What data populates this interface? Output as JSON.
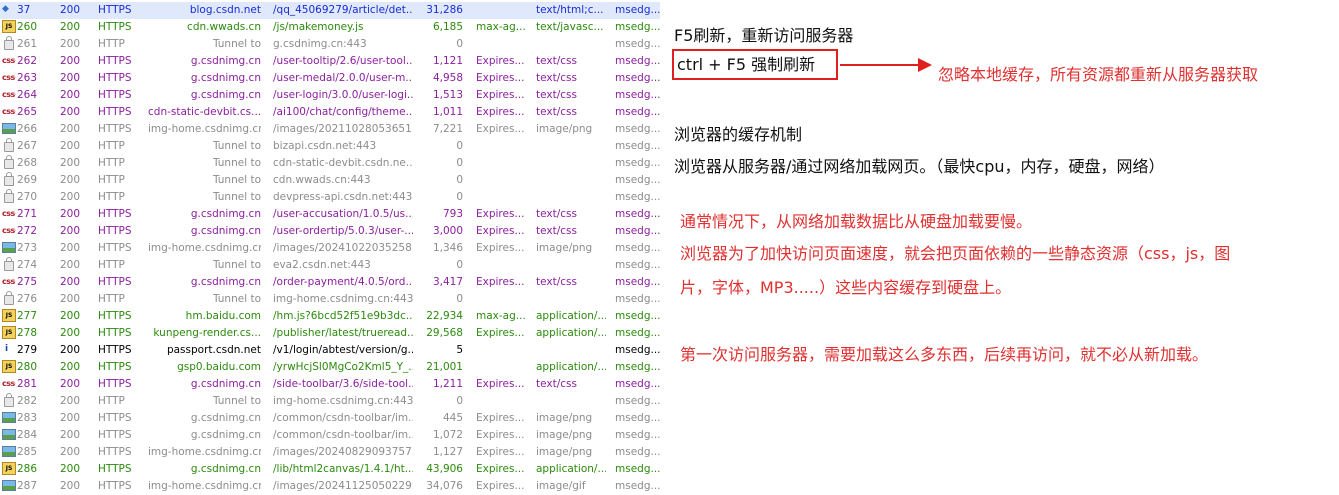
{
  "sessions": [
    {
      "icon": "arrow",
      "num": "37",
      "result": "200",
      "protocol": "HTTPS",
      "host": "blog.csdn.net",
      "url": "/qq_45069279/article/det...",
      "body": "31,286",
      "caching": "",
      "ctype": "text/html;c...",
      "process": "msedg...",
      "color": "blue",
      "selected": true
    },
    {
      "icon": "js",
      "num": "260",
      "result": "200",
      "protocol": "HTTPS",
      "host": "cdn.wwads.cn",
      "url": "/js/makemoney.js",
      "body": "6,185",
      "caching": "max-ag...",
      "ctype": "text/javasc...",
      "process": "msedg...",
      "color": "green",
      "selected": false
    },
    {
      "icon": "lock",
      "num": "261",
      "result": "200",
      "protocol": "HTTP",
      "host": "Tunnel to",
      "url": "g.csdnimg.cn:443",
      "body": "0",
      "caching": "",
      "ctype": "",
      "process": "msedg...",
      "color": "gray",
      "selected": false
    },
    {
      "icon": "css",
      "num": "262",
      "result": "200",
      "protocol": "HTTPS",
      "host": "g.csdnimg.cn",
      "url": "/user-tooltip/2.6/user-tool...",
      "body": "1,121",
      "caching": "Expires...",
      "ctype": "text/css",
      "process": "msedg...",
      "color": "purple",
      "selected": false
    },
    {
      "icon": "css",
      "num": "263",
      "result": "200",
      "protocol": "HTTPS",
      "host": "g.csdnimg.cn",
      "url": "/user-medal/2.0.0/user-m...",
      "body": "4,958",
      "caching": "Expires...",
      "ctype": "text/css",
      "process": "msedg...",
      "color": "purple",
      "selected": false
    },
    {
      "icon": "css",
      "num": "264",
      "result": "200",
      "protocol": "HTTPS",
      "host": "g.csdnimg.cn",
      "url": "/user-login/3.0.0/user-logi...",
      "body": "1,513",
      "caching": "Expires...",
      "ctype": "text/css",
      "process": "msedg...",
      "color": "purple",
      "selected": false
    },
    {
      "icon": "css",
      "num": "265",
      "result": "200",
      "protocol": "HTTPS",
      "host": "cdn-static-devbit.cs...",
      "url": "/ai100/chat/config/theme...",
      "body": "1,011",
      "caching": "Expires...",
      "ctype": "text/css",
      "process": "msedg...",
      "color": "purple",
      "selected": false
    },
    {
      "icon": "img",
      "num": "266",
      "result": "200",
      "protocol": "HTTPS",
      "host": "img-home.csdnimg.cn",
      "url": "/images/20211028053651...",
      "body": "7,221",
      "caching": "Expires...",
      "ctype": "image/png",
      "process": "msedg...",
      "color": "gray",
      "selected": false
    },
    {
      "icon": "lock",
      "num": "267",
      "result": "200",
      "protocol": "HTTP",
      "host": "Tunnel to",
      "url": "bizapi.csdn.net:443",
      "body": "0",
      "caching": "",
      "ctype": "",
      "process": "msedg...",
      "color": "gray",
      "selected": false
    },
    {
      "icon": "lock",
      "num": "268",
      "result": "200",
      "protocol": "HTTP",
      "host": "Tunnel to",
      "url": "cdn-static-devbit.csdn.ne...",
      "body": "0",
      "caching": "",
      "ctype": "",
      "process": "msedg...",
      "color": "gray",
      "selected": false
    },
    {
      "icon": "lock",
      "num": "269",
      "result": "200",
      "protocol": "HTTP",
      "host": "Tunnel to",
      "url": "cdn.wwads.cn:443",
      "body": "0",
      "caching": "",
      "ctype": "",
      "process": "msedg...",
      "color": "gray",
      "selected": false
    },
    {
      "icon": "lock",
      "num": "270",
      "result": "200",
      "protocol": "HTTP",
      "host": "Tunnel to",
      "url": "devpress-api.csdn.net:443",
      "body": "0",
      "caching": "",
      "ctype": "",
      "process": "msedg...",
      "color": "gray",
      "selected": false
    },
    {
      "icon": "css",
      "num": "271",
      "result": "200",
      "protocol": "HTTPS",
      "host": "g.csdnimg.cn",
      "url": "/user-accusation/1.0.5/us...",
      "body": "793",
      "caching": "Expires...",
      "ctype": "text/css",
      "process": "msedg...",
      "color": "purple",
      "selected": false
    },
    {
      "icon": "css",
      "num": "272",
      "result": "200",
      "protocol": "HTTPS",
      "host": "g.csdnimg.cn",
      "url": "/user-ordertip/5.0.3/user-...",
      "body": "3,000",
      "caching": "Expires...",
      "ctype": "text/css",
      "process": "msedg...",
      "color": "purple",
      "selected": false
    },
    {
      "icon": "img",
      "num": "273",
      "result": "200",
      "protocol": "HTTPS",
      "host": "img-home.csdnimg.cn",
      "url": "/images/20241022035258...",
      "body": "1,346",
      "caching": "Expires...",
      "ctype": "image/png",
      "process": "msedg...",
      "color": "gray",
      "selected": false
    },
    {
      "icon": "lock",
      "num": "274",
      "result": "200",
      "protocol": "HTTP",
      "host": "Tunnel to",
      "url": "eva2.csdn.net:443",
      "body": "0",
      "caching": "",
      "ctype": "",
      "process": "msedg...",
      "color": "gray",
      "selected": false
    },
    {
      "icon": "css",
      "num": "275",
      "result": "200",
      "protocol": "HTTPS",
      "host": "g.csdnimg.cn",
      "url": "/order-payment/4.0.5/ord...",
      "body": "3,417",
      "caching": "Expires...",
      "ctype": "text/css",
      "process": "msedg...",
      "color": "purple",
      "selected": false
    },
    {
      "icon": "lock",
      "num": "276",
      "result": "200",
      "protocol": "HTTP",
      "host": "Tunnel to",
      "url": "img-home.csdnimg.cn:443",
      "body": "0",
      "caching": "",
      "ctype": "",
      "process": "msedg...",
      "color": "gray",
      "selected": false
    },
    {
      "icon": "js",
      "num": "277",
      "result": "200",
      "protocol": "HTTPS",
      "host": "hm.baidu.com",
      "url": "/hm.js?6bcd52f51e9b3dc...",
      "body": "22,934",
      "caching": "max-ag...",
      "ctype": "application/...",
      "process": "msedg...",
      "color": "green",
      "selected": false
    },
    {
      "icon": "js",
      "num": "278",
      "result": "200",
      "protocol": "HTTPS",
      "host": "kunpeng-render.cs...",
      "url": "/publisher/latest/trueread...",
      "body": "29,568",
      "caching": "Expires...",
      "ctype": "application/...",
      "process": "msedg...",
      "color": "green",
      "selected": false
    },
    {
      "icon": "info",
      "num": "279",
      "result": "200",
      "protocol": "HTTPS",
      "host": "passport.csdn.net",
      "url": "/v1/login/abtest/version/g...",
      "body": "5",
      "caching": "",
      "ctype": "",
      "process": "msedg...",
      "color": "black",
      "selected": false
    },
    {
      "icon": "js",
      "num": "280",
      "result": "200",
      "protocol": "HTTPS",
      "host": "gsp0.baidu.com",
      "url": "/yrwHcjSl0MgCo2Kml5_Y_...",
      "body": "21,001",
      "caching": "",
      "ctype": "application/...",
      "process": "msedg...",
      "color": "green",
      "selected": false
    },
    {
      "icon": "css",
      "num": "281",
      "result": "200",
      "protocol": "HTTPS",
      "host": "g.csdnimg.cn",
      "url": "/side-toolbar/3.6/side-tool...",
      "body": "1,211",
      "caching": "Expires...",
      "ctype": "text/css",
      "process": "msedg...",
      "color": "purple",
      "selected": false
    },
    {
      "icon": "lock",
      "num": "282",
      "result": "200",
      "protocol": "HTTP",
      "host": "Tunnel to",
      "url": "img-home.csdnimg.cn:443",
      "body": "0",
      "caching": "",
      "ctype": "",
      "process": "msedg...",
      "color": "gray",
      "selected": false
    },
    {
      "icon": "img",
      "num": "283",
      "result": "200",
      "protocol": "HTTPS",
      "host": "g.csdnimg.cn",
      "url": "/common/csdn-toolbar/im...",
      "body": "445",
      "caching": "Expires...",
      "ctype": "image/png",
      "process": "msedg...",
      "color": "gray",
      "selected": false
    },
    {
      "icon": "img",
      "num": "284",
      "result": "200",
      "protocol": "HTTPS",
      "host": "g.csdnimg.cn",
      "url": "/common/csdn-toolbar/im...",
      "body": "1,072",
      "caching": "Expires...",
      "ctype": "image/png",
      "process": "msedg...",
      "color": "gray",
      "selected": false
    },
    {
      "icon": "img",
      "num": "285",
      "result": "200",
      "protocol": "HTTPS",
      "host": "img-home.csdnimg.cn",
      "url": "/images/20240829093757...",
      "body": "1,127",
      "caching": "Expires...",
      "ctype": "image/png",
      "process": "msedg...",
      "color": "gray",
      "selected": false
    },
    {
      "icon": "js",
      "num": "286",
      "result": "200",
      "protocol": "HTTPS",
      "host": "g.csdnimg.cn",
      "url": "/lib/html2canvas/1.4.1/ht...",
      "body": "43,906",
      "caching": "Expires...",
      "ctype": "application/...",
      "process": "msedg...",
      "color": "green",
      "selected": false
    },
    {
      "icon": "img",
      "num": "287",
      "result": "200",
      "protocol": "HTTPS",
      "host": "img-home.csdnimg.cn",
      "url": "/images/20241125050229...",
      "body": "34,076",
      "caching": "Expires...",
      "ctype": "image/gif",
      "process": "msedg...",
      "color": "gray",
      "selected": false
    }
  ],
  "notes": {
    "f5": "F5刷新，重新访问服务器",
    "ctrl_f5": "ctrl + F5  强制刷新",
    "ignore_cache": "忽略本地缓存，所有资源都重新从服务器获取",
    "cache_title": "浏览器的缓存机制",
    "cache_desc": "浏览器从服务器/通过网络加载网页。（最快cpu，内存，硬盘，网络）",
    "red1": "通常情况下，从网络加载数据比从硬盘加载要慢。",
    "red2": "浏览器为了加快访问页面速度，就会把页面依赖的一些静态资源（css，js，图",
    "red3": "片，字体，MP3.....）这些内容缓存到硬盘上。",
    "red4": "第一次访问服务器，需要加载这么多东西，后续再访问，就不必从新加载。"
  },
  "colors": {
    "accent_red": "#e03030",
    "css_purple": "#8b1f9e",
    "js_green": "#2c8a0d",
    "html_blue": "#1a2bd6",
    "tunnel_gray": "#8c8c8c"
  }
}
